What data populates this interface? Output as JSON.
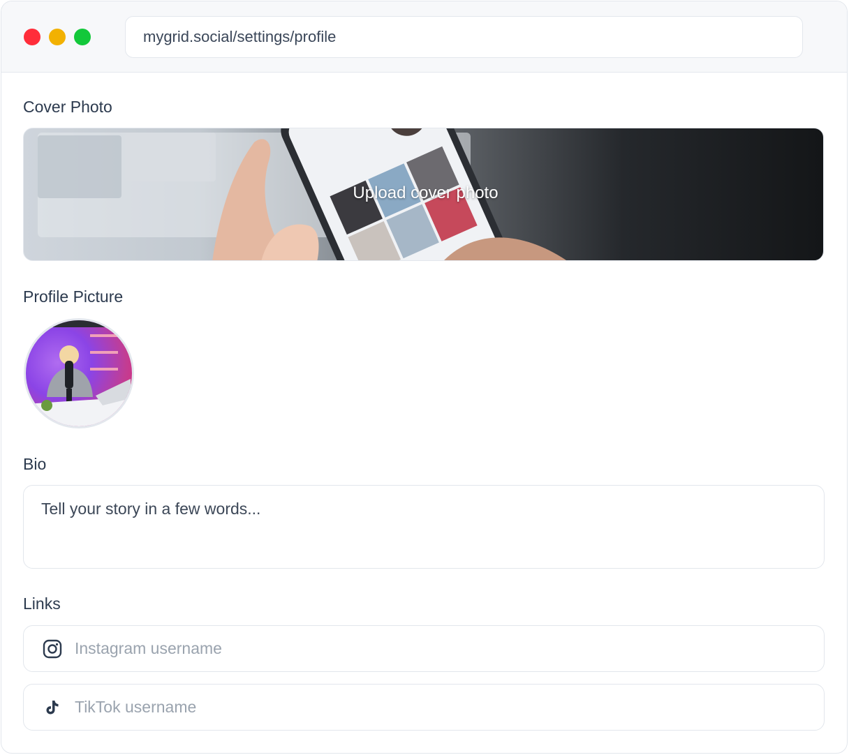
{
  "browser": {
    "url": "mygrid.social/settings/profile",
    "dots": {
      "close": "#ff2d3a",
      "minimize": "#f2b101",
      "maximize": "#13c83a"
    }
  },
  "profile": {
    "cover": {
      "label": "Cover Photo",
      "upload_text": "Upload cover photo"
    },
    "picture": {
      "label": "Profile Picture"
    },
    "bio": {
      "label": "Bio",
      "placeholder": "Tell your story in a few words..."
    },
    "links": {
      "label": "Links",
      "instagram": {
        "placeholder": "Instagram username",
        "icon": "instagram-icon"
      },
      "tiktok": {
        "placeholder": "TikTok username",
        "icon": "tiktok-icon"
      }
    }
  }
}
